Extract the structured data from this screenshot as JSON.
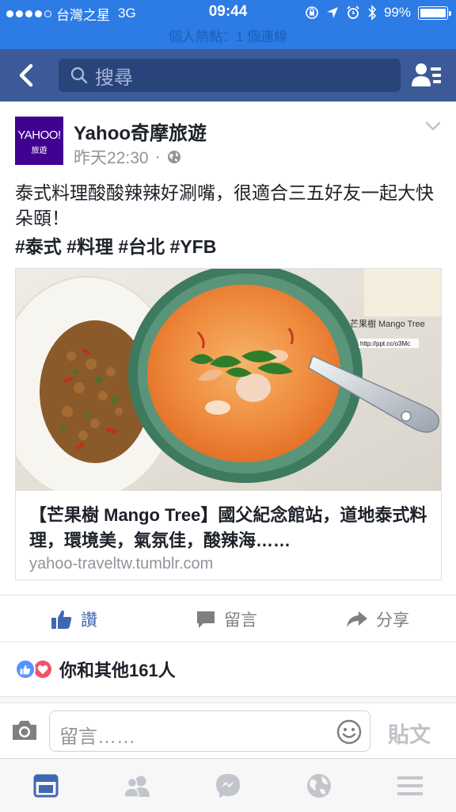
{
  "status_bar": {
    "carrier": "台灣之星",
    "network": "3G",
    "time": "09:44",
    "battery": "99%",
    "battery_level": 0.99,
    "hotspot": "個人熱點：1 個連線"
  },
  "nav": {
    "search_placeholder": "搜尋"
  },
  "post": {
    "page_logo_main": "YAHOO!",
    "page_logo_sub": "旅遊",
    "page_name": "Yahoo奇摩旅遊",
    "timestamp": "昨天22:30",
    "meta_separator": "·",
    "text": "泰式料理酸酸辣辣好涮嘴，很適合三五好友一起大快朵頤！",
    "hashtags": "#泰式 #料理 #台北 #YFB",
    "link": {
      "image_watermark": "芒果樹 Mango Tree",
      "image_url_watermark": "http://ppt.cc/o3Mc",
      "title": "【芒果樹 Mango Tree】國父紀念館站，道地泰式料理，環境美，氣氛佳，酸辣海……",
      "domain": "yahoo-traveltw.tumblr.com"
    }
  },
  "actions": {
    "like": "讚",
    "comment": "留言",
    "share": "分享"
  },
  "reactions": {
    "text": "你和其他161人"
  },
  "comment_bar": {
    "placeholder": "留言……",
    "post_label": "貼文"
  },
  "icons": {
    "back": "chevron-left-icon",
    "search": "search-icon",
    "friends": "friend-requests-icon",
    "globe": "globe-icon",
    "camera": "camera-icon",
    "emoji": "smiley-icon",
    "tabs": [
      "news-feed-icon",
      "friends-icon",
      "messenger-icon",
      "notifications-globe-icon",
      "menu-icon"
    ]
  },
  "colors": {
    "status_bar": "#2d7be5",
    "nav_bar": "#3b5a97",
    "like_blue": "#4267b2",
    "yahoo_purple": "#400191"
  }
}
